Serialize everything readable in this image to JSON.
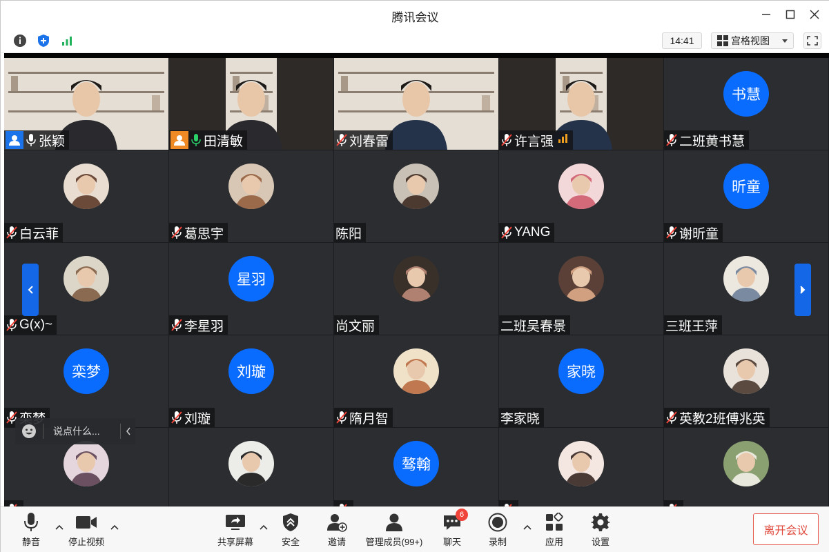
{
  "window": {
    "title": "腾讯会议"
  },
  "topbar": {
    "time": "14:41",
    "view_label": "宫格视图"
  },
  "tiles": [
    {
      "name": "张颖",
      "type": "camera",
      "mic": "on",
      "role": "host"
    },
    {
      "name": "田清敏",
      "type": "camera",
      "mic": "on",
      "role": "cohost",
      "active": true
    },
    {
      "name": "刘春雷",
      "type": "camera",
      "mic": "muted"
    },
    {
      "name": "许言强",
      "type": "camera",
      "mic": "muted",
      "signal": true
    },
    {
      "name": "二班黄书慧",
      "type": "text",
      "avatar_text": "书慧",
      "mic": "muted"
    },
    {
      "name": "白云菲",
      "type": "photo",
      "mic": "muted"
    },
    {
      "name": "葛思宇",
      "type": "photo",
      "mic": "muted"
    },
    {
      "name": "陈阳",
      "type": "photo",
      "mic": "none"
    },
    {
      "name": "YANG",
      "type": "photo",
      "mic": "muted"
    },
    {
      "name": "谢昕童",
      "type": "text",
      "avatar_text": "昕童",
      "mic": "muted"
    },
    {
      "name": "G(x)~",
      "type": "photo",
      "mic": "muted"
    },
    {
      "name": "李星羽",
      "type": "text",
      "avatar_text": "星羽",
      "mic": "muted"
    },
    {
      "name": "尚文丽",
      "type": "photo",
      "mic": "none"
    },
    {
      "name": "二班吴春景",
      "type": "photo",
      "mic": "none"
    },
    {
      "name": "三班王萍",
      "type": "photo",
      "mic": "none"
    },
    {
      "name": "栾梦",
      "type": "text",
      "avatar_text": "栾梦",
      "mic": "muted"
    },
    {
      "name": "刘璇",
      "type": "text",
      "avatar_text": "刘璇",
      "mic": "muted"
    },
    {
      "name": "隋月智",
      "type": "photo",
      "mic": "muted"
    },
    {
      "name": "李家晓",
      "type": "text",
      "avatar_text": "家晓",
      "mic": "none"
    },
    {
      "name": "英教2班傅兆英",
      "type": "photo",
      "mic": "muted"
    },
    {
      "name": "",
      "type": "photo",
      "mic": "muted"
    },
    {
      "name": "",
      "type": "photo",
      "mic": "none"
    },
    {
      "name": "",
      "type": "text",
      "avatar_text": "骜翰",
      "mic": "muted"
    },
    {
      "name": "",
      "type": "photo",
      "mic": "muted"
    },
    {
      "name": "",
      "type": "photo",
      "mic": "muted"
    }
  ],
  "chat_input": {
    "placeholder": "说点什么..."
  },
  "toolbar": {
    "mute": "静音",
    "stop_video": "停止视频",
    "share_screen": "共享屏幕",
    "security": "安全",
    "invite": "邀请",
    "manage_members": "管理成员(99+)",
    "chat": "聊天",
    "chat_badge": "6",
    "record": "录制",
    "apps": "应用",
    "settings": "设置",
    "leave": "离开会议"
  },
  "colors": {
    "accent": "#0a6cff",
    "leave": "#e0473b",
    "badge": "#f0443a",
    "active_border": "#2bbf6b"
  }
}
